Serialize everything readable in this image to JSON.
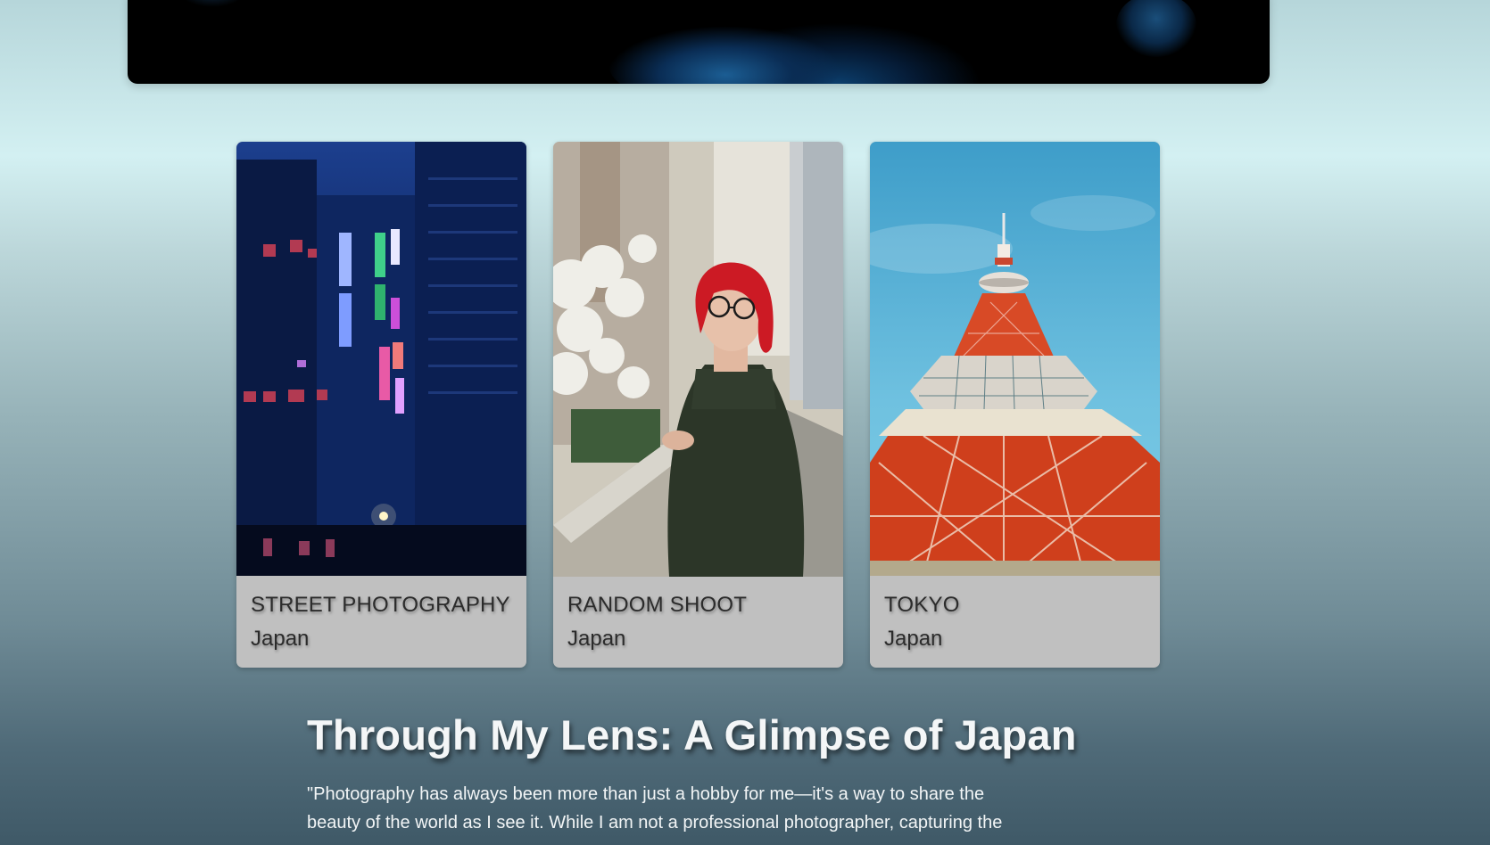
{
  "gallery": {
    "cards": [
      {
        "title": "STREET PHOTOGRAPHY",
        "subtitle": "Japan"
      },
      {
        "title": "RANDOM SHOOT",
        "subtitle": "Japan"
      },
      {
        "title": "TOKYO",
        "subtitle": "Japan"
      }
    ]
  },
  "article": {
    "title": "Through My Lens: A Glimpse of Japan",
    "intro": "\"Photography has always been more than just a hobby for me—it's a way to share the beauty of the world as I see it. While I am not a professional photographer, capturing the"
  }
}
